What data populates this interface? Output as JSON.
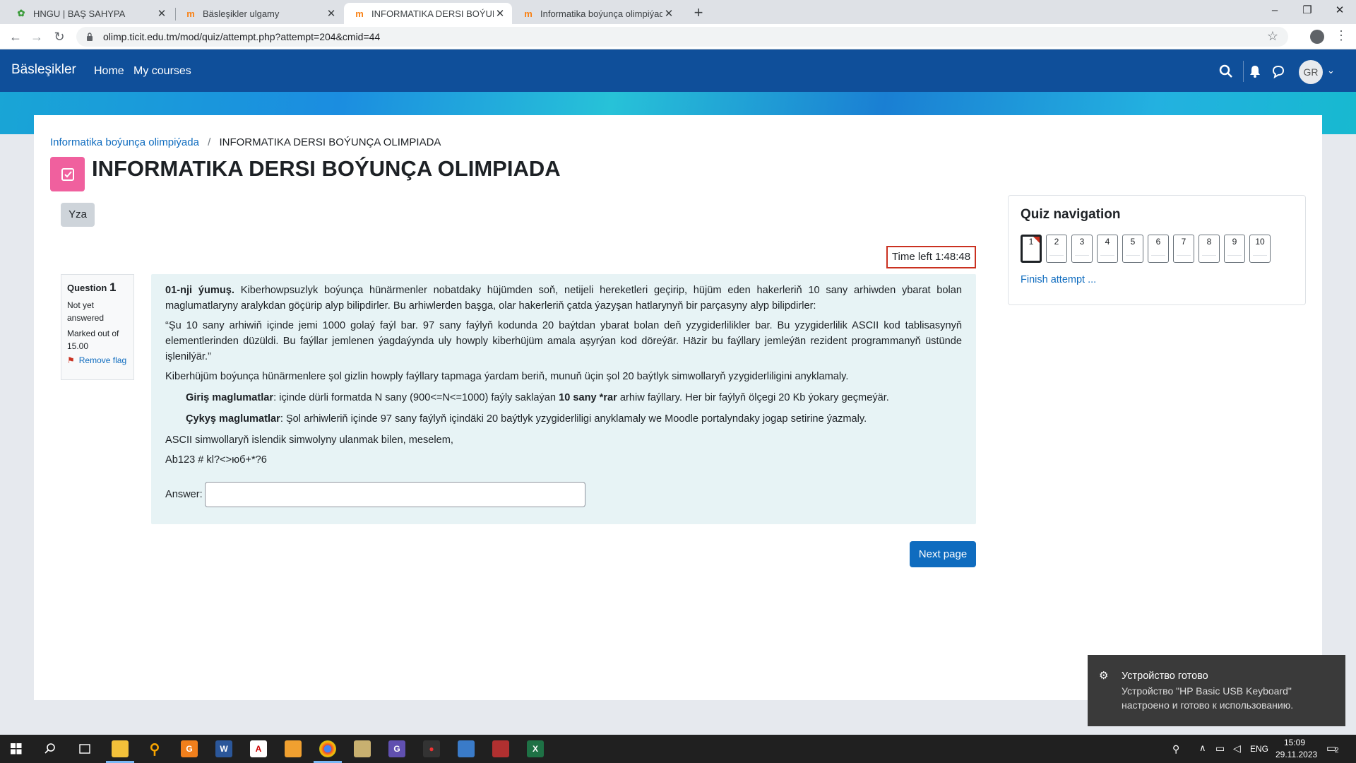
{
  "browser": {
    "tabs": [
      {
        "title": "HNGU | BAŞ SAHYPA",
        "icon": "hngu-favicon-icon",
        "active": false
      },
      {
        "title": "Bäsleşikler ulgamy",
        "icon": "moodle-favicon-icon",
        "active": false
      },
      {
        "title": "INFORMATIKA DERSI BOÝUNÇA OLIMPIADA",
        "icon": "moodle-favicon-icon",
        "active": true
      },
      {
        "title": "Informatika boýunça olimpiýada",
        "icon": "moodle-favicon-icon",
        "active": false
      }
    ],
    "new_tab_label": "+",
    "url": "olimp.ticit.edu.tm/mod/quiz/attempt.php?attempt=204&cmid=44"
  },
  "navbar": {
    "brand": "Bäsleşikler",
    "links": [
      "Home",
      "My courses"
    ],
    "user_initials": "GR",
    "accent": "#0f4f9a"
  },
  "breadcrumb": {
    "parent": "Informatika boýunça olimpiýada",
    "current": "INFORMATIKA DERSI BOÝUNÇA OLIMPIADA"
  },
  "page": {
    "title": "INFORMATIKA DERSI BOÝUNÇA OLIMPIADA",
    "icon": "quiz-checkbox-icon",
    "yza_button": "Yza",
    "timer": "Time left 1:48:48",
    "next_button": "Next page"
  },
  "question_info": {
    "label": "Question",
    "number": "1",
    "status": "Not yet answered",
    "marked_out_of": "Marked out of 15.00",
    "flag_label": "Remove flag"
  },
  "question": {
    "heading": "01-nji ýumuş.",
    "intro": "Kiberhowpsuzlyk boýunça hünärmenler nobatdaky hüjümden soň, netijeli hereketleri geçirip, hüjüm eden hakerleriň 10 sany arhiwden ybarat bolan maglumatlaryny aralykdan göçürip alyp bilipdirler. Bu arhiwlerden başga, olar hakerleriň çatda ýazyşan hatlarynyň bir parçasyny alyp bilipdirler:",
    "quote": "“Şu 10 sany arhiwiň içinde jemi 1000 golaý faýl bar. 97 sany faýlyň kodunda 20 baýtdan ybarat bolan deň yzygiderlilikler bar. Bu yzygiderlilik ASCII kod tablisasynyň elementlerinden düzüldi. Bu faýllar jemlenen ýagdaýynda uly howply kiberhüjüm amala aşyrýan kod döreýär. Häzir bu faýllary jemleýän rezident programmanyň üstünde işlenilýär.”",
    "task": "Kiberhüjüm boýunça hünärmenlere şol gizlin howply faýllary tapmaga ýardam beriň, munuň üçin şol 20 baýtlyk simwollaryň yzygiderliligini anyklamaly.",
    "input_label": "Giriş maglumatlar",
    "input_text_1": ": içinde dürli formatda N sany (900<=N<=1000) faýly saklaýan ",
    "input_bold": "10 sany *rar",
    "input_text_2": " arhiw faýllary. Her bir faýlyň ölçegi 20 Kb ýokary geçmeýär.",
    "output_label": "Çykyş maglumatlar",
    "output_text": ": Şol arhiwleriň içinde 97 sany faýlyň içindäki 20 baýtlyk yzygiderliligi anyklamaly we Moodle portalyndaky jogap setirine ýazmaly.",
    "ascii_note": "ASCII simwollaryň islendik simwolyny ulanmak bilen, meselem,",
    "example": "Ab123 # kl?<>юб+*?6",
    "answer_label": "Answer:",
    "answer_value": ""
  },
  "quiz_nav": {
    "title": "Quiz navigation",
    "buttons": [
      "1",
      "2",
      "3",
      "4",
      "5",
      "6",
      "7",
      "8",
      "9",
      "10"
    ],
    "current": "1",
    "finish": "Finish attempt ..."
  },
  "toast": {
    "title": "Устройство готово",
    "body": "Устройство \"HP Basic USB Keyboard\" настроено и готово к использованию."
  },
  "taskbar": {
    "language": "ENG",
    "time": "15:09",
    "date": "29.11.2023",
    "notification_count": "2"
  }
}
